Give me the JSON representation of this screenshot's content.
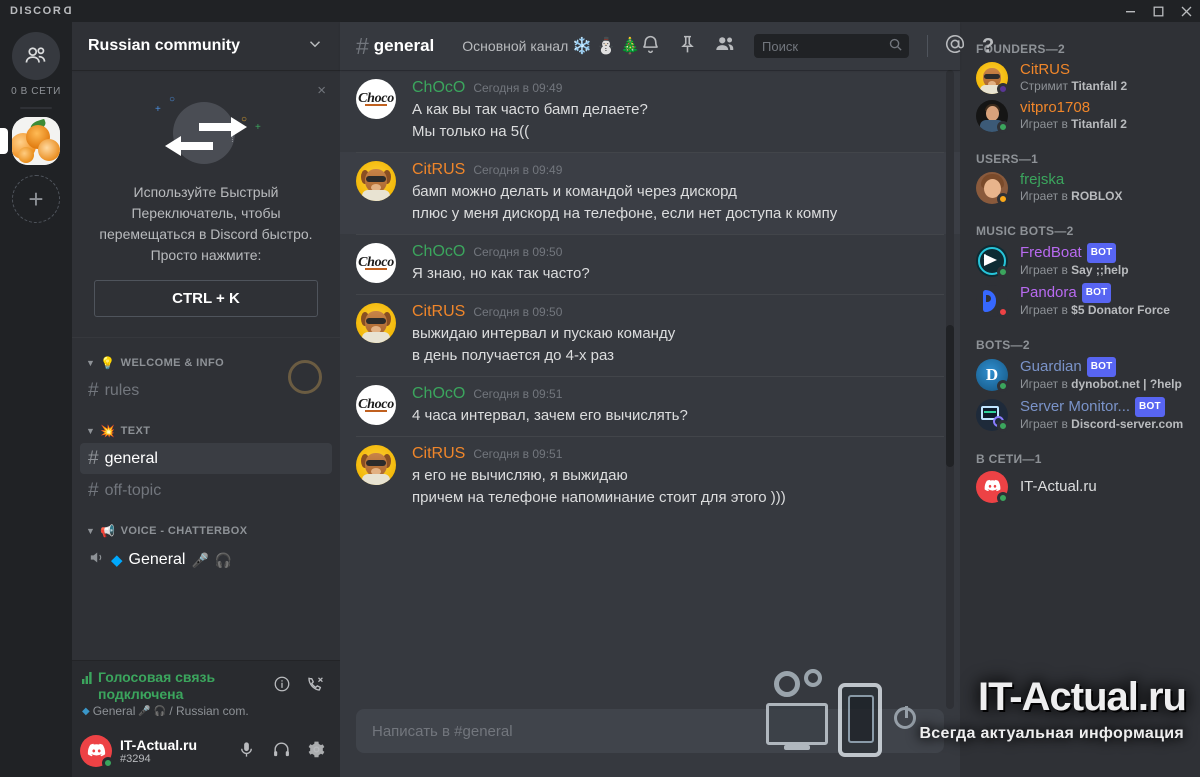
{
  "titlebar": {
    "wordmark": "DISCOR",
    "wordmark_flipped": "D",
    "minimize": "minimize",
    "maximize": "maximize",
    "close": "close"
  },
  "rail": {
    "home_label": "home-icon",
    "online_status": "0 В СЕТИ",
    "guild_name": "Russian community",
    "add_label": "+"
  },
  "sidebar": {
    "guild_name": "Russian community",
    "promo": {
      "text": "Используйте Быстрый Переключатель, чтобы перемещаться в Discord быстро. Просто нажмите:",
      "key": "CTRL + K",
      "close": "×"
    },
    "categories": [
      {
        "emoji": "💡",
        "label": "WELCOME & INFO",
        "channels": [
          {
            "name": "rules",
            "type": "text",
            "active": false
          }
        ]
      },
      {
        "emoji": "💥",
        "label": "TEXT",
        "channels": [
          {
            "name": "general",
            "type": "text",
            "active": true
          },
          {
            "name": "off-topic",
            "type": "text",
            "active": false
          }
        ]
      },
      {
        "emoji": "📢",
        "label": "VOICE - CHATTERBOX",
        "channels": [
          {
            "name": "General",
            "type": "voice",
            "active": false
          }
        ]
      }
    ],
    "voice_panel": {
      "title": "Голосовая связь подключена",
      "subtitle": "General",
      "subtitle_suffix": "/ Russian com.",
      "info_icon": "info-icon",
      "disconnect_icon": "disconnect-call-icon"
    },
    "user": {
      "name": "IT-Actual.ru",
      "tag": "#3294",
      "mic_icon": "microphone-icon",
      "headphones_icon": "headphones-icon",
      "settings_icon": "gear-icon"
    }
  },
  "channel_header": {
    "hash": "#",
    "name": "general",
    "topic": "Основной канал",
    "topic_emojis": [
      "❄️",
      "⛄",
      "🎄"
    ],
    "icons": {
      "notifications": "bell-icon",
      "pinned": "pin-icon",
      "members": "members-icon",
      "mentions": "mentions-icon",
      "help": "help-icon"
    },
    "search": {
      "placeholder": "Поиск",
      "icon": "search-icon"
    }
  },
  "messages": [
    {
      "author": "ChOcO",
      "author_color": "#3ba55d",
      "avatar": "choco",
      "timestamp": "Сегодня в 09:49",
      "lines": [
        "А как вы так часто бамп делаете?",
        "Мы только на 5(("
      ],
      "highlighted": false
    },
    {
      "author": "CitRUS",
      "author_color": "#f0862a",
      "avatar": "dog",
      "timestamp": "Сегодня в 09:49",
      "lines": [
        "бамп можно делать и командой через дискорд",
        "плюс у меня дискорд на телефоне, если нет доступа к компу"
      ],
      "highlighted": true
    },
    {
      "author": "ChOcO",
      "author_color": "#3ba55d",
      "avatar": "choco",
      "timestamp": "Сегодня в 09:50",
      "lines": [
        "Я знаю, но как так часто?"
      ],
      "highlighted": false
    },
    {
      "author": "CitRUS",
      "author_color": "#f0862a",
      "avatar": "dog",
      "timestamp": "Сегодня в 09:50",
      "lines": [
        "выжидаю интервал и пускаю команду",
        "в день получается до 4-х раз"
      ],
      "highlighted": false
    },
    {
      "author": "ChOcO",
      "author_color": "#3ba55d",
      "avatar": "choco",
      "timestamp": "Сегодня в 09:51",
      "lines": [
        "4 часа интервал, зачем его вычислять?"
      ],
      "highlighted": false
    },
    {
      "author": "CitRUS",
      "author_color": "#f0862a",
      "avatar": "dog",
      "timestamp": "Сегодня в 09:51",
      "lines": [
        "я его не вычисляю, я выжидаю",
        "причем на телефоне напоминание стоит для этого )))"
      ],
      "highlighted": false
    }
  ],
  "composer": {
    "placeholder": "Написать в #general"
  },
  "members": {
    "groups": [
      {
        "label": "FOUNDERS—2",
        "items": [
          {
            "name": "CitRUS",
            "name_color": "#f0862a",
            "avatar": "dog2",
            "status_prefix": "Стримит ",
            "status_strong": "Titanfall 2",
            "dot_color": "#593695",
            "bot": false
          },
          {
            "name": "vitpro1708",
            "name_color": "#f0862a",
            "avatar": "vit",
            "status_prefix": "Играет в ",
            "status_strong": "Titanfall 2",
            "dot_color": "#3ba55d",
            "bot": false
          }
        ]
      },
      {
        "label": "USERS—1",
        "items": [
          {
            "name": "frejska",
            "name_color": "#3ba55d",
            "avatar": "frej",
            "status_prefix": "Играет в ",
            "status_strong": "ROBLOX",
            "dot_color": "#faa81a",
            "bot": false
          }
        ]
      },
      {
        "label": "MUSIC BOTS—2",
        "items": [
          {
            "name": "FredBoat",
            "name_color": "#b86af0",
            "avatar": "fred",
            "status_prefix": "Играет в ",
            "status_strong": "Say ;;help",
            "dot_color": "#3ba55d",
            "bot": true,
            "bot_label": "BOT"
          },
          {
            "name": "Pandora",
            "name_color": "#b86af0",
            "avatar": "pan",
            "status_prefix": "Играет в ",
            "status_strong": "$5 Donator Force",
            "dot_color": "#ed4245",
            "bot": true,
            "bot_label": "BOT"
          }
        ]
      },
      {
        "label": "BOTS—2",
        "items": [
          {
            "name": "Guardian",
            "name_color": "#7a93c9",
            "avatar": "guard",
            "status_prefix": "Играет в ",
            "status_strong": "dynobot.net | ?help",
            "dot_color": "#3ba55d",
            "bot": true,
            "bot_label": "BOT"
          },
          {
            "name": "Server Monitor...",
            "name_color": "#7a93c9",
            "avatar": "srv",
            "status_prefix": "Играет в ",
            "status_strong": "Discord-server.com",
            "dot_color": "#3ba55d",
            "bot": true,
            "bot_label": "BOT"
          }
        ]
      },
      {
        "label": "В СЕТИ—1",
        "items": [
          {
            "name": "IT-Actual.ru",
            "name_color": "#dcddde",
            "avatar": "itact",
            "status_prefix": "",
            "status_strong": "",
            "dot_color": "#3ba55d",
            "bot": false
          }
        ]
      }
    ]
  },
  "watermark": {
    "line1": "IT-Actual.ru",
    "line2": "Всегда актуальная информация"
  },
  "colors": {
    "accent_green": "#3ba55d",
    "accent_orange": "#f0862a",
    "bot_badge": "#5865f2",
    "sidebar_bg": "#2f3136",
    "main_bg": "#36393f",
    "rail_bg": "#202225"
  }
}
